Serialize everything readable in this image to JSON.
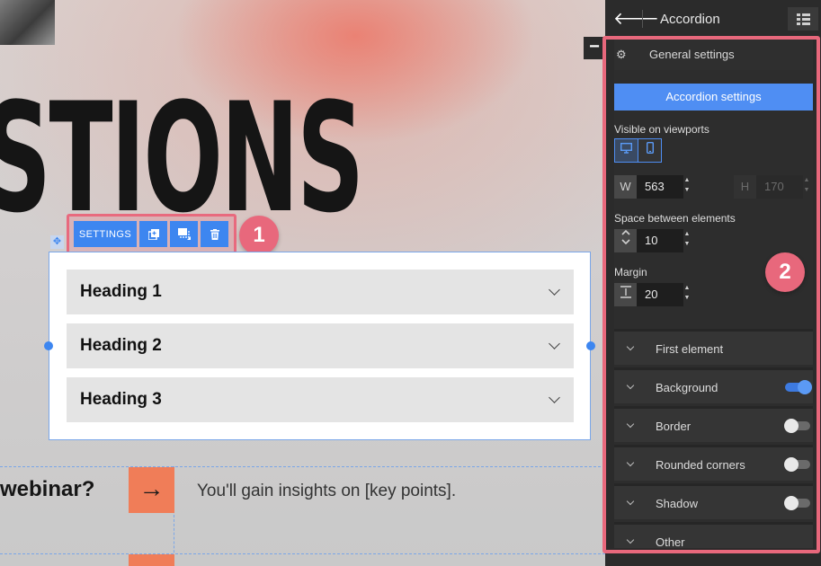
{
  "canvas": {
    "big_title": "STIONS",
    "toolbar": {
      "settings_label": "SETTINGS",
      "duplicate_icon": "duplicate-icon",
      "layer_icon": "layer-icon",
      "delete_icon": "trash-icon"
    },
    "badges": [
      "1",
      "2"
    ],
    "accordion": {
      "items": [
        {
          "heading": "Heading 1"
        },
        {
          "heading": "Heading 2"
        },
        {
          "heading": "Heading 3"
        }
      ]
    },
    "webinar_text": "webinar?",
    "arrow": "→",
    "insights_text": "You'll gain insights on [key points]."
  },
  "panel": {
    "title": "Accordion",
    "general_settings": "General settings",
    "accordion_settings_button": "Accordion settings",
    "visible_on_viewports": "Visible on viewports",
    "width_prefix": "W",
    "width_value": "563",
    "height_prefix": "H",
    "height_value": "170",
    "space_label": "Space between elements",
    "space_value": "10",
    "margin_label": "Margin",
    "margin_value": "20",
    "sections": [
      {
        "label": "First element",
        "toggle": null
      },
      {
        "label": "Background",
        "toggle": "on"
      },
      {
        "label": "Border",
        "toggle": "off"
      },
      {
        "label": "Rounded corners",
        "toggle": "off"
      },
      {
        "label": "Shadow",
        "toggle": "off"
      },
      {
        "label": "Other",
        "toggle": null
      }
    ]
  },
  "colors": {
    "accent_blue": "#3d86f0",
    "highlight_pink": "#e8687c",
    "arrow_orange": "#f07d58",
    "panel_bg": "#2b2b2b"
  }
}
